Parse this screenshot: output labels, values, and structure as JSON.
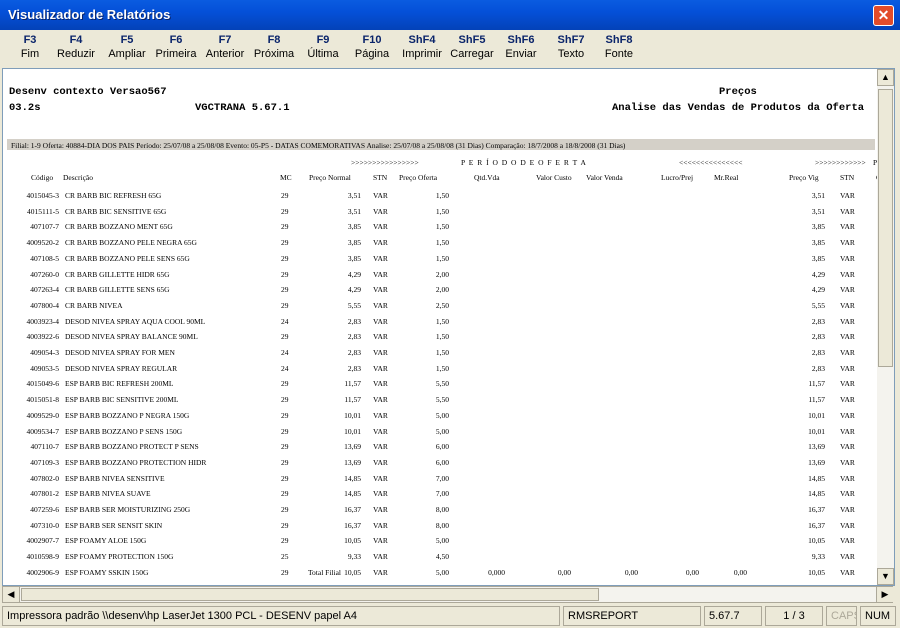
{
  "window": {
    "title": "Visualizador de Relatórios"
  },
  "toolbar": [
    {
      "key": "F3",
      "label": "Fim"
    },
    {
      "key": "F4",
      "label": "Reduzir"
    },
    {
      "key": "F5",
      "label": "Ampliar"
    },
    {
      "key": "F6",
      "label": "Primeira"
    },
    {
      "key": "F7",
      "label": "Anterior"
    },
    {
      "key": "F8",
      "label": "Próxima"
    },
    {
      "key": "F9",
      "label": "Última"
    },
    {
      "key": "F10",
      "label": "Página"
    },
    {
      "key": "ShF4",
      "label": "Imprimir"
    },
    {
      "key": "ShF5",
      "label": "Carregar"
    },
    {
      "key": "ShF6",
      "label": "Enviar"
    },
    {
      "key": "ShF7",
      "label": "Texto"
    },
    {
      "key": "ShF8",
      "label": "Fonte"
    }
  ],
  "report": {
    "env": "Desenv contexto Versao567",
    "version": "03.2s",
    "program": "VGCTRANA 5.67.1",
    "title": "Preços",
    "subtitle": "Analise das Vendas de Produtos da Oferta",
    "filter_line": "Filial: 1-9  Oferta: 40884-DIA DOS PAIS  Período: 25/07/08 a 25/08/08  Evento: 05-P5 - DATAS COMEMORATIVAS  Analise: 25/07/08 a 25/08/08 (31 Dias)  Comparação: 18/7/2008 a 18/8/2008 (31 Dias)",
    "period_arrows_left": ">>>>>>>>>>>>>>>>",
    "period_label": "P E R Í O D O     D E     O F E R T A",
    "period_arrows_right": "<<<<<<<<<<<<<<<",
    "period2_arrows": ">>>>>>>>>>>>",
    "period2_letter": "P",
    "columns": {
      "codigo": "Código",
      "descricao": "Descrição",
      "mc": "MC",
      "preco_normal": "Preço Normal",
      "stn": "STN",
      "preco_oferta": "Preço Oferta",
      "qtd_vda": "Qtd.Vda",
      "valor_custo": "Valor Custo",
      "valor_venda": "Valor Venda",
      "lucro_prej": "Lucro/Prej",
      "mr_real": "Mr.Real",
      "preco_vig": "Preço Vig",
      "stn2": "STN",
      "extra": "C"
    },
    "rows": [
      [
        "4015045-3",
        "CR BARB BIC REFRESH 65G",
        "29",
        "3,51",
        "VAR",
        "1,50",
        "3,51",
        "VAR"
      ],
      [
        "4015111-5",
        "CR BARB BIC SENSITIVE 65G",
        "29",
        "3,51",
        "VAR",
        "1,50",
        "3,51",
        "VAR"
      ],
      [
        "407107-7",
        "CR BARB BOZZANO MENT 65G",
        "29",
        "3,85",
        "VAR",
        "1,50",
        "3,85",
        "VAR"
      ],
      [
        "4009520-2",
        "CR BARB BOZZANO PELE NEGRA 65G",
        "29",
        "3,85",
        "VAR",
        "1,50",
        "3,85",
        "VAR"
      ],
      [
        "407108-5",
        "CR BARB BOZZANO PELE SENS 65G",
        "29",
        "3,85",
        "VAR",
        "1,50",
        "3,85",
        "VAR"
      ],
      [
        "407260-0",
        "CR BARB GILLETTE HIDR 65G",
        "29",
        "4,29",
        "VAR",
        "2,00",
        "4,29",
        "VAR"
      ],
      [
        "407263-4",
        "CR BARB GILLETTE SENS 65G",
        "29",
        "4,29",
        "VAR",
        "2,00",
        "4,29",
        "VAR"
      ],
      [
        "407800-4",
        "CR BARB NIVEA",
        "29",
        "5,55",
        "VAR",
        "2,50",
        "5,55",
        "VAR"
      ],
      [
        "4003923-4",
        "DESOD NIVEA SPRAY AQUA COOL 90ML",
        "24",
        "2,83",
        "VAR",
        "1,50",
        "2,83",
        "VAR"
      ],
      [
        "4003922-6",
        "DESOD NIVEA SPRAY BALANCE 90ML",
        "29",
        "2,83",
        "VAR",
        "1,50",
        "2,83",
        "VAR"
      ],
      [
        "409054-3",
        "DESOD NIVEA SPRAY FOR MEN",
        "24",
        "2,83",
        "VAR",
        "1,50",
        "2,83",
        "VAR"
      ],
      [
        "409053-5",
        "DESOD NIVEA SPRAY REGULAR",
        "24",
        "2,83",
        "VAR",
        "1,50",
        "2,83",
        "VAR"
      ],
      [
        "4015049-6",
        "ESP BARB BIC REFRESH 200ML",
        "29",
        "11,57",
        "VAR",
        "5,50",
        "11,57",
        "VAR"
      ],
      [
        "4015051-8",
        "ESP BARB BIC SENSITIVE 200ML",
        "29",
        "11,57",
        "VAR",
        "5,50",
        "11,57",
        "VAR"
      ],
      [
        "4009529-0",
        "ESP BARB BOZZANO P NEGRA 150G",
        "29",
        "10,01",
        "VAR",
        "5,00",
        "10,01",
        "VAR"
      ],
      [
        "4009534-7",
        "ESP BARB BOZZANO P SENS 150G",
        "29",
        "10,01",
        "VAR",
        "5,00",
        "10,01",
        "VAR"
      ],
      [
        "407110-7",
        "ESP BARB BOZZANO PROTECT P SENS",
        "29",
        "13,69",
        "VAR",
        "6,00",
        "13,69",
        "VAR"
      ],
      [
        "407109-3",
        "ESP BARB BOZZANO PROTECTION HIDR",
        "29",
        "13,69",
        "VAR",
        "6,00",
        "13,69",
        "VAR"
      ],
      [
        "407802-0",
        "ESP BARB NIVEA SENSITIVE",
        "29",
        "14,85",
        "VAR",
        "7,00",
        "14,85",
        "VAR"
      ],
      [
        "407801-2",
        "ESP BARB NIVEA SUAVE",
        "29",
        "14,85",
        "VAR",
        "7,00",
        "14,85",
        "VAR"
      ],
      [
        "407259-6",
        "ESP BARB SER MOISTURIZING 250G",
        "29",
        "16,37",
        "VAR",
        "8,00",
        "16,37",
        "VAR"
      ],
      [
        "407310-0",
        "ESP BARB SER SENSIT SKIN",
        "29",
        "16,37",
        "VAR",
        "8,00",
        "16,37",
        "VAR"
      ],
      [
        "4002907-7",
        "ESP FOAMY ALOE 150G",
        "29",
        "10,05",
        "VAR",
        "5,00",
        "10,05",
        "VAR"
      ],
      [
        "4010598-9",
        "ESP FOAMY PROTECTION 150G",
        "25",
        "9,33",
        "VAR",
        "4,50",
        "9,33",
        "VAR"
      ],
      [
        "4002906-9",
        "ESP FOAMY SSKIN 150G",
        "29",
        "10,05",
        "VAR",
        "5,00",
        "10,05",
        "VAR"
      ]
    ],
    "total": {
      "label": "Total Filial",
      "qtd": "0,000",
      "custo": "0,00",
      "venda": "0,00",
      "lucro": "0,00",
      "mr": "0,00"
    }
  },
  "status": {
    "printer": "Impressora padrão \\\\desenv\\hp LaserJet 1300 PCL - DESENV papel A4",
    "system": "RMSREPORT",
    "version": "5.67.7",
    "page": "1 / 3",
    "caps": "CAPS",
    "num": "NUM"
  }
}
